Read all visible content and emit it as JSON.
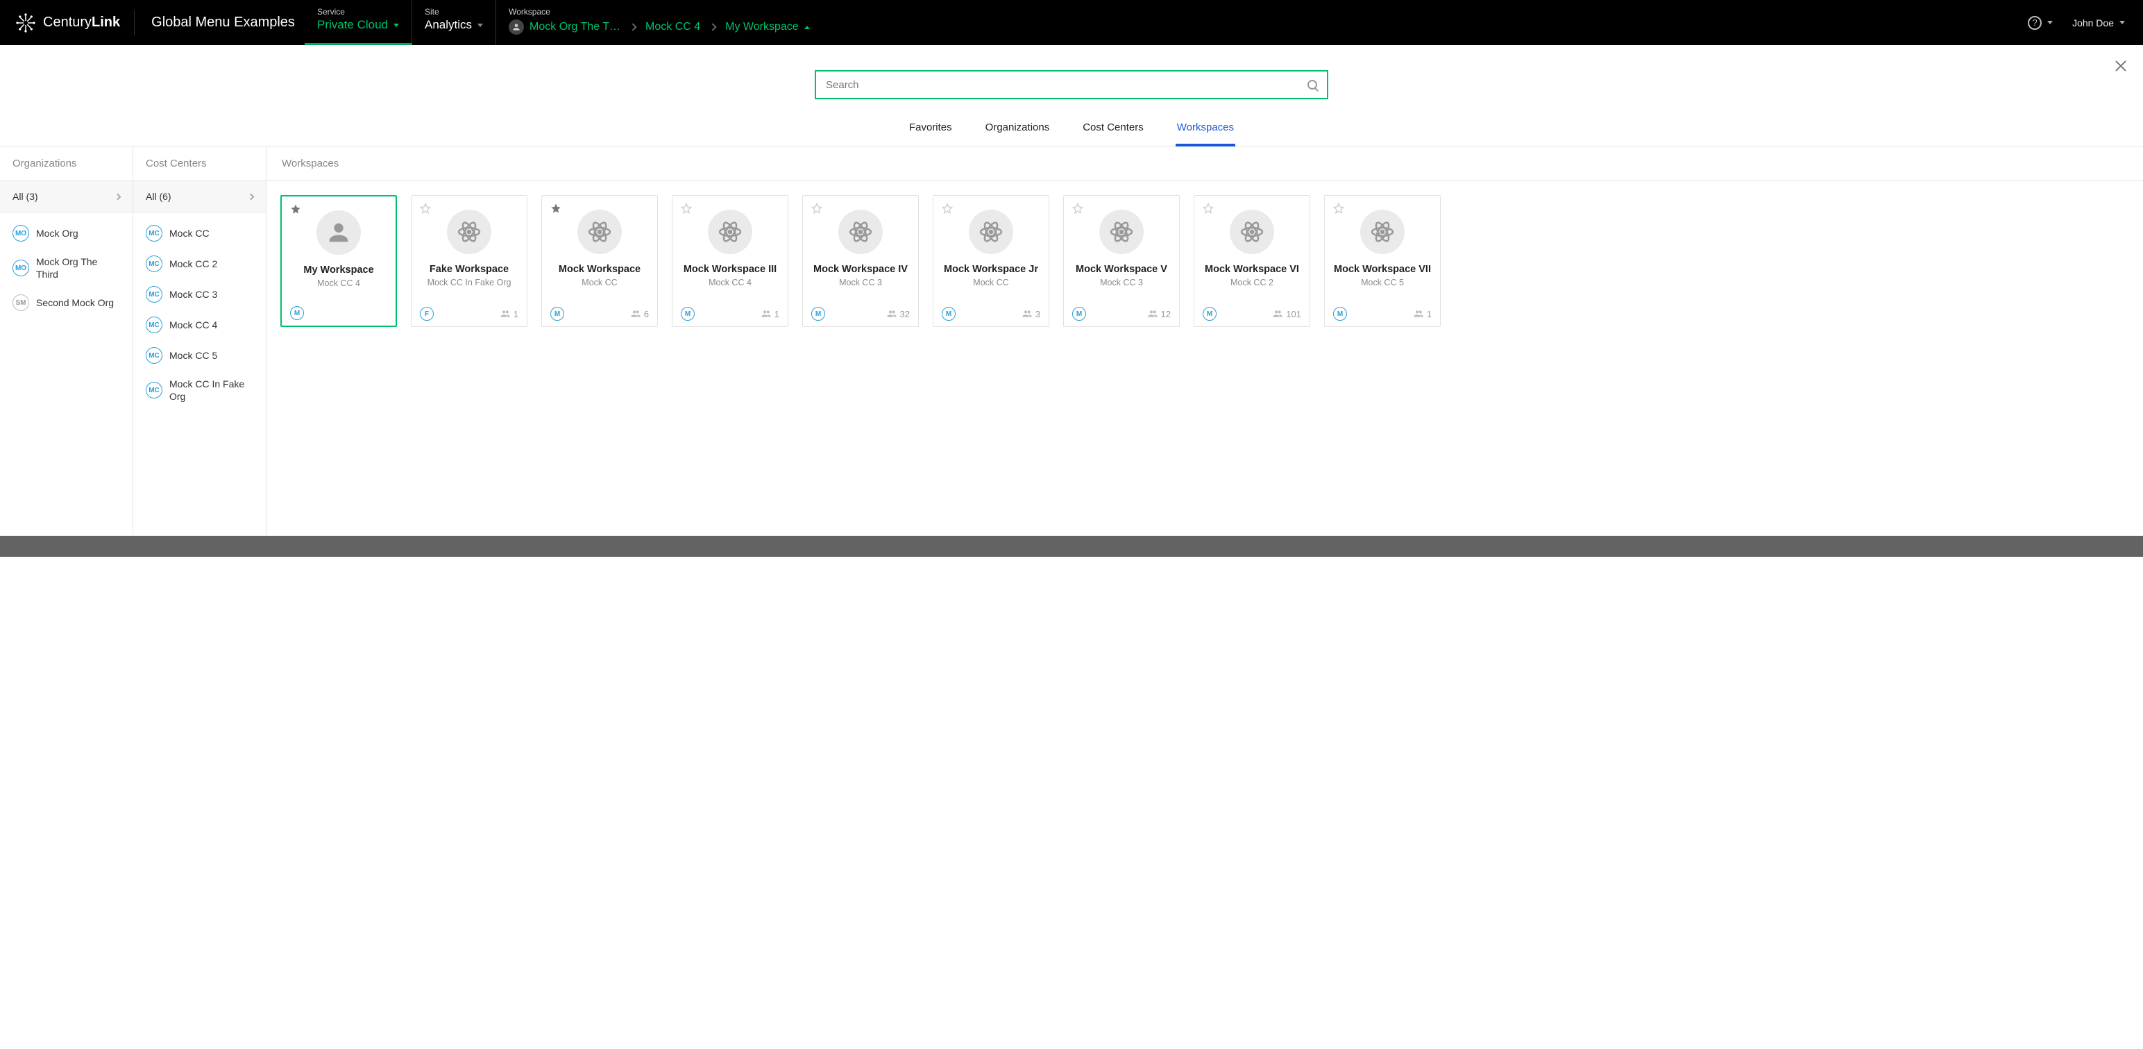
{
  "brand": {
    "first": "Century",
    "second": "Link"
  },
  "app_title": "Global Menu Examples",
  "nav": {
    "service": {
      "label": "Service",
      "value": "Private Cloud"
    },
    "site": {
      "label": "Site",
      "value": "Analytics"
    },
    "workspace": {
      "label": "Workspace",
      "crumbs": [
        {
          "text": "Mock Org The T…",
          "avatar": true
        },
        {
          "text": "Mock CC 4"
        },
        {
          "text": "My Workspace",
          "caret_up": true
        }
      ]
    }
  },
  "user_name": "John Doe",
  "search": {
    "placeholder": "Search"
  },
  "cat_tabs": [
    {
      "label": "Favorites",
      "active": false
    },
    {
      "label": "Organizations",
      "active": false
    },
    {
      "label": "Cost Centers",
      "active": false
    },
    {
      "label": "Workspaces",
      "active": true
    }
  ],
  "cols": {
    "orgs": {
      "title": "Organizations",
      "all_label": "All (3)",
      "items": [
        {
          "badge": "MO",
          "label": "Mock Org"
        },
        {
          "badge": "MO",
          "label": "Mock Org The Third"
        },
        {
          "badge": "SM",
          "label": "Second Mock Org",
          "gray": true
        }
      ]
    },
    "ccs": {
      "title": "Cost Centers",
      "all_label": "All (6)",
      "items": [
        {
          "badge": "MC",
          "label": "Mock CC"
        },
        {
          "badge": "MC",
          "label": "Mock CC 2"
        },
        {
          "badge": "MC",
          "label": "Mock CC 3"
        },
        {
          "badge": "MC",
          "label": "Mock CC 4"
        },
        {
          "badge": "MC",
          "label": "Mock CC 5"
        },
        {
          "badge": "MC",
          "label": "Mock CC In Fake Org"
        }
      ]
    },
    "workspaces": {
      "title": "Workspaces",
      "cards": [
        {
          "name": "My Workspace",
          "parent": "Mock CC 4",
          "badge": "M",
          "members": "",
          "star_filled": true,
          "selected": true,
          "avatar": "person"
        },
        {
          "name": "Fake Workspace",
          "parent": "Mock CC In Fake Org",
          "badge": "F",
          "members": "1",
          "star_filled": false,
          "selected": false,
          "avatar": "atom"
        },
        {
          "name": "Mock Workspace",
          "parent": "Mock CC",
          "badge": "M",
          "members": "6",
          "star_filled": true,
          "selected": false,
          "avatar": "atom"
        },
        {
          "name": "Mock Workspace III",
          "parent": "Mock CC 4",
          "badge": "M",
          "members": "1",
          "star_filled": false,
          "selected": false,
          "avatar": "atom"
        },
        {
          "name": "Mock Workspace IV",
          "parent": "Mock CC 3",
          "badge": "M",
          "members": "32",
          "star_filled": false,
          "selected": false,
          "avatar": "atom"
        },
        {
          "name": "Mock Workspace Jr",
          "parent": "Mock CC",
          "badge": "M",
          "members": "3",
          "star_filled": false,
          "selected": false,
          "avatar": "atom"
        },
        {
          "name": "Mock Workspace V",
          "parent": "Mock CC 3",
          "badge": "M",
          "members": "12",
          "star_filled": false,
          "selected": false,
          "avatar": "atom"
        },
        {
          "name": "Mock Workspace VI",
          "parent": "Mock CC 2",
          "badge": "M",
          "members": "101",
          "star_filled": false,
          "selected": false,
          "avatar": "atom"
        },
        {
          "name": "Mock Workspace VII",
          "parent": "Mock CC 5",
          "badge": "M",
          "members": "1",
          "star_filled": false,
          "selected": false,
          "avatar": "atom"
        }
      ]
    }
  }
}
